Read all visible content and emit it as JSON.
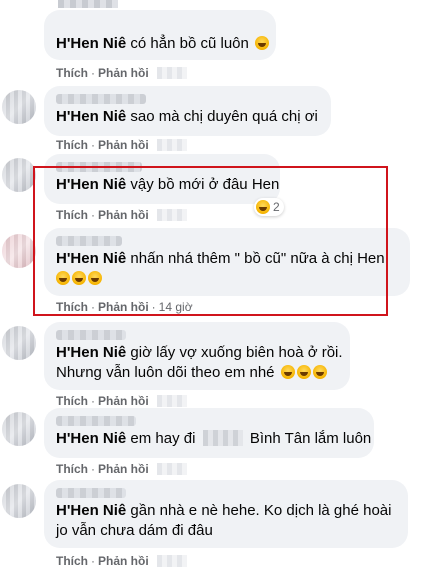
{
  "comments": [
    {
      "tag": "H'Hen Niê",
      "text": "có hẳn bồ cũ luôn",
      "text_line2": "",
      "actions": {
        "like": "Thích",
        "reply": "Phản hồi",
        "sep": "·",
        "time": ""
      },
      "emoji_count": 1
    },
    {
      "tag": "H'Hen Niê",
      "text": "sao mà chị duyên quá chị ơi",
      "text_line2": "",
      "actions": {
        "like": "Thích",
        "reply": "Phản hồi",
        "sep": "·",
        "time": ""
      },
      "emoji_count": 0
    },
    {
      "tag": "H'Hen Niê",
      "text": "vậy bồ mới ở đâu Hen",
      "text_line2": "",
      "actions": {
        "like": "Thích",
        "reply": "Phản hồi",
        "sep": "·",
        "time": ""
      },
      "reaction_count": "2"
    },
    {
      "tag": "H'Hen Niê",
      "text": "nhấn nhá thêm \" bồ cũ\" nữa à chị Hen",
      "text_line2": "",
      "actions": {
        "like": "Thích",
        "reply": "Phản hồi",
        "sep": "·",
        "time": "14 giờ"
      },
      "emoji_count": 3
    },
    {
      "tag": "H'Hen Niê",
      "text": "giờ lấy vợ xuống biên hoà ở rồi.",
      "text_line2": "Nhưng vẫn luôn dõi theo em nhé",
      "actions": {
        "like": "Thích",
        "reply": "Phản hồi",
        "sep": "·",
        "time": ""
      },
      "emoji_count": 3
    },
    {
      "tag": "H'Hen Niê",
      "text_before": "em hay đi",
      "text_after": "Bình Tân lắm luôn",
      "actions": {
        "like": "Thích",
        "reply": "Phản hồi",
        "sep": "·",
        "time": ""
      }
    },
    {
      "tag": "H'Hen Niê",
      "text": "gần nhà e nè hehe. Ko dịch là ghé hoài",
      "text_line2": "jo vẫn chưa dám đi đâu",
      "actions": {
        "like": "Thích",
        "reply": "Phản hồi",
        "sep": "·",
        "time": ""
      }
    }
  ],
  "colors": {
    "bubble": "#f0f2f5",
    "text": "#050505",
    "meta": "#65676b",
    "highlight": "#d0141c"
  },
  "icons": {
    "laughing": "laughing-tears-emoji",
    "reaction": "haha-reaction-icon"
  }
}
